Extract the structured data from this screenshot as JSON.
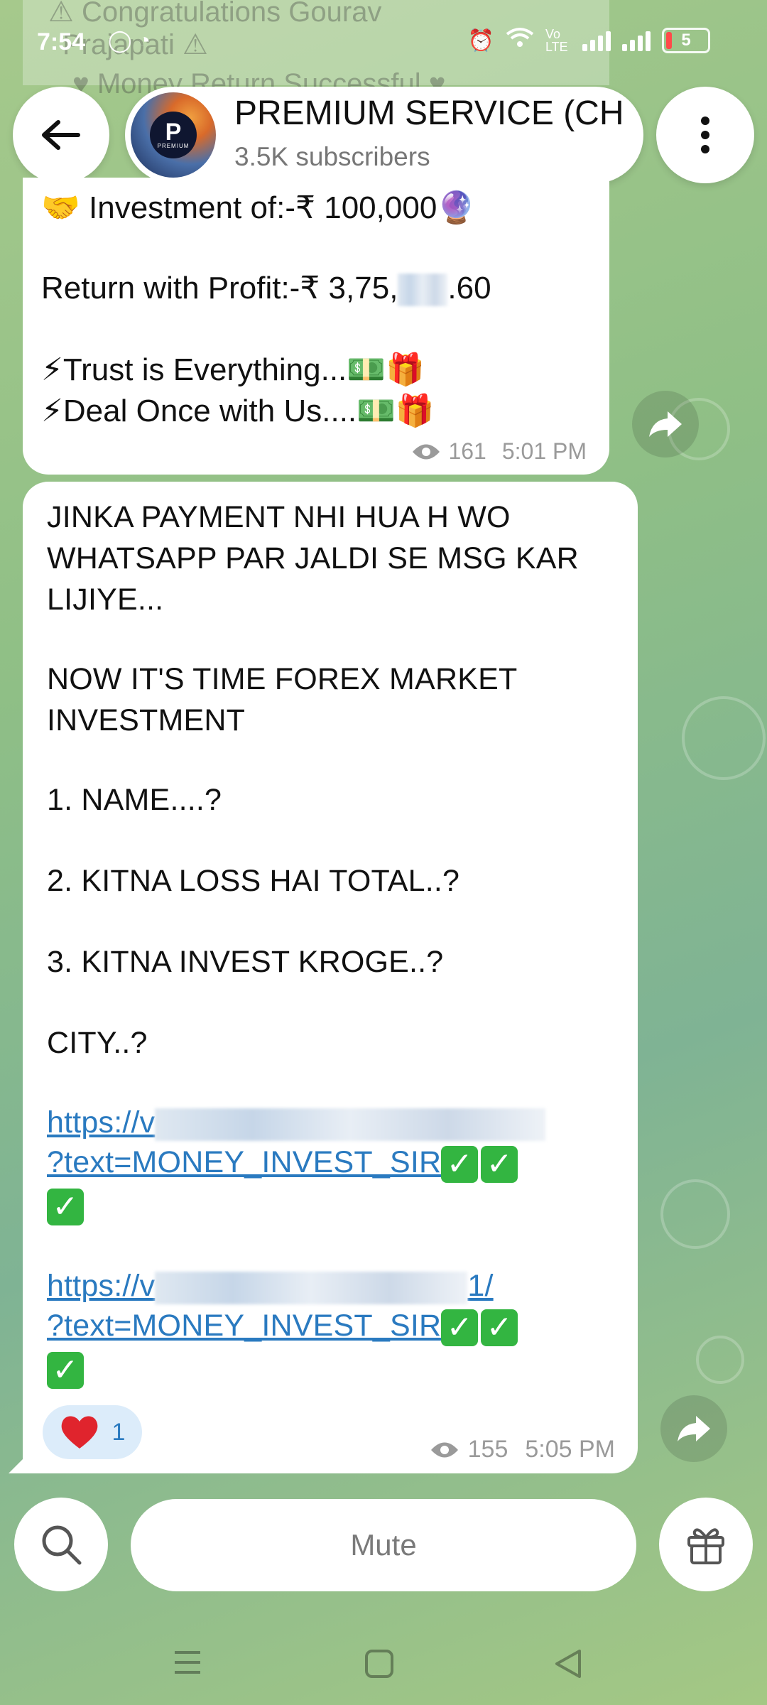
{
  "status_bar": {
    "time": "7:54",
    "battery": "5",
    "network": "Vo LTE"
  },
  "background_faded": {
    "line1": "⚠ Congratulations Gourav",
    "line2": "Prajapati ⚠",
    "line3": "♥ Money Return Successful ♥"
  },
  "header": {
    "channel_name": "PREMIUM SERVICE (CH",
    "subscribers": "3.5K subscribers",
    "avatar_text": "P",
    "avatar_small": "PREMIUM"
  },
  "message1": {
    "line1": "🤝 Investment of:-₹ 100,000🔮",
    "line2_prefix": "Return with Profit:-₹ 3,75,",
    "line2_suffix": ".60",
    "line3": "⚡Trust is Everything...💵🎁",
    "line4": "⚡Deal Once with Us....💵🎁",
    "views": "161",
    "time": "5:01 PM"
  },
  "message2": {
    "l1": "JINKA PAYMENT NHI HUA H WO",
    "l2": "WHATSAPP PAR JALDI SE MSG KAR",
    "l3": "LIJIYE...",
    "l4": "NOW IT'S TIME FOREX MARKET",
    "l5": "INVESTMENT",
    "l6": "1. NAME....?",
    "l7": "2. KITNA LOSS HAI TOTAL..?",
    "l8": "3. KITNA INVEST KROGE..?",
    "l9": "CITY..?",
    "link1_prefix": "https://v",
    "link1_query": "?text=MONEY_INVEST_SIR",
    "link2_prefix": "https://v",
    "link2_tail": "1/",
    "link2_query": "?text=MONEY_INVEST_SIR",
    "reaction_count": "1",
    "views": "155",
    "time": "5:05 PM"
  },
  "bottom_bar": {
    "mute_label": "Mute"
  },
  "colors": {
    "accent": "#2a7ac0",
    "check": "#33b541",
    "background": "#8fbf86"
  }
}
